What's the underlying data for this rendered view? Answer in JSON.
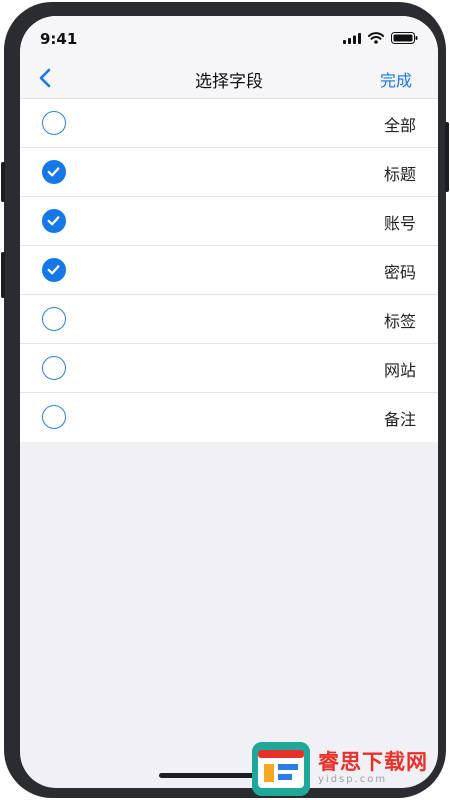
{
  "status_bar": {
    "time": "9:41"
  },
  "nav": {
    "title": "选择字段",
    "done_label": "完成"
  },
  "fields": [
    {
      "label": "全部",
      "checked": false
    },
    {
      "label": "标题",
      "checked": true
    },
    {
      "label": "账号",
      "checked": true
    },
    {
      "label": "密码",
      "checked": true
    },
    {
      "label": "标签",
      "checked": false
    },
    {
      "label": "网站",
      "checked": false
    },
    {
      "label": "备注",
      "checked": false
    }
  ],
  "watermark": {
    "text": "睿思下载网",
    "url": "yidsp.com"
  },
  "colors": {
    "accent": "#1677e6",
    "background": "#f1f1f5",
    "frame": "#2b2c30"
  },
  "icons": {
    "back": "chevron-left-icon",
    "check": "checkmark-icon",
    "signal": "signal-icon",
    "wifi": "wifi-icon",
    "battery": "battery-icon"
  }
}
